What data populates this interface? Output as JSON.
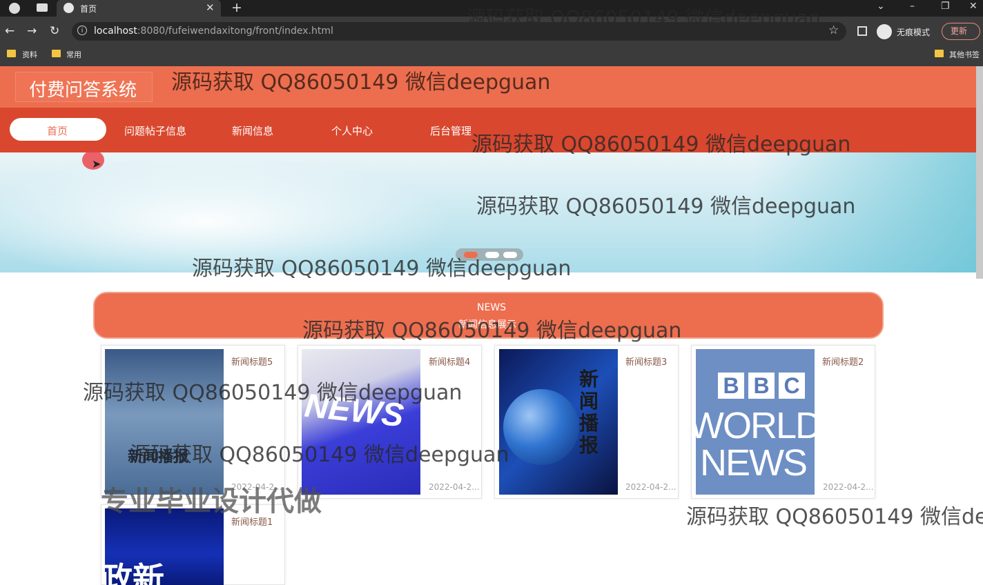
{
  "browser": {
    "tab_title": "首页",
    "url_host": "localhost",
    "url_rest": ":8080/fufeiwendaxitong/front/index.html",
    "incognito_label": "无痕模式",
    "update_label": "更新",
    "bookmarks": [
      "资料",
      "常用"
    ],
    "other_bookmarks": "其他书签"
  },
  "site": {
    "logo": "付费问答系统",
    "nav": [
      "首页",
      "问题帖子信息",
      "新闻信息",
      "个人中心",
      "后台管理"
    ]
  },
  "news_section": {
    "title_en": "NEWS",
    "title_cn": "新闻信息展示",
    "cards": [
      {
        "title": "新闻标题5",
        "date": "2022-04-2...",
        "thumb_text": "新闻播报"
      },
      {
        "title": "新闻标题4",
        "date": "2022-04-2...",
        "thumb_text": "NEWS"
      },
      {
        "title": "新闻标题3",
        "date": "2022-04-2...",
        "thumb_text": "新闻播报"
      },
      {
        "title": "新闻标题2",
        "date": "2022-04-2...",
        "thumb_text": [
          "B",
          "B",
          "C",
          "WORLD",
          "NEWS"
        ]
      },
      {
        "title": "新闻标题1",
        "date": "",
        "thumb_text": "政新"
      }
    ]
  },
  "watermark": {
    "text": "源码获取 QQ86050149 微信deepguan",
    "text_cut": "源码获取 QQ86050149 微信dee",
    "promo": "专业毕业设计代做"
  },
  "colors": {
    "header": "#ec6e4f",
    "nav": "#d9472e",
    "accent": "#ec6e4f"
  }
}
